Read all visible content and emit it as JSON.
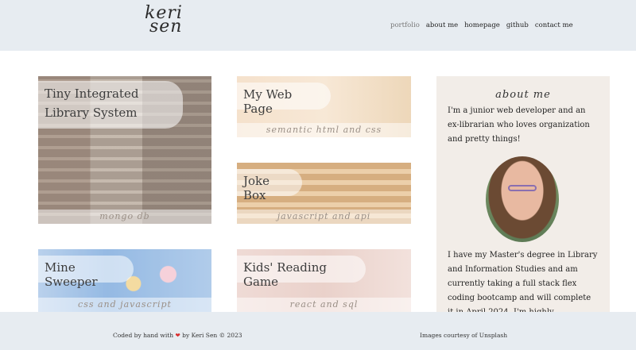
{
  "header": {
    "logo_line1": "keri",
    "logo_line2": "sen",
    "nav": [
      {
        "label": "portfolio"
      },
      {
        "label": "about me"
      },
      {
        "label": "homepage"
      },
      {
        "label": "github"
      },
      {
        "label": "contact me"
      }
    ]
  },
  "projects": [
    {
      "title": "Tiny Integrated Library System",
      "tech": "mongo db"
    },
    {
      "title": "My Web Page",
      "tech": "semantic html and css"
    },
    {
      "title": "Joke Box",
      "tech": "javascript and api"
    },
    {
      "title": "Mine Sweeper",
      "tech": "css and javascript"
    },
    {
      "title": "Kids' Reading Game",
      "tech": "react and sql"
    }
  ],
  "about": {
    "heading": "about me",
    "intro": "I'm a junior web developer and an ex-librarian who loves organization and pretty things!",
    "body": "I have my Master's degree in Library and Information Studies and am currently taking a full stack flex coding bootcamp and will complete it in April 2024. I'm highly resourceful"
  },
  "footer": {
    "left_prefix": "Coded by hand with",
    "heart": "❤",
    "left_suffix": "by Keri Sen © 2023",
    "right": "Images courtesy of Unsplash"
  },
  "colors": {
    "header_bg": "#e7ecf1",
    "about_bg": "#f2ede8",
    "heart": "#d92c2c"
  }
}
